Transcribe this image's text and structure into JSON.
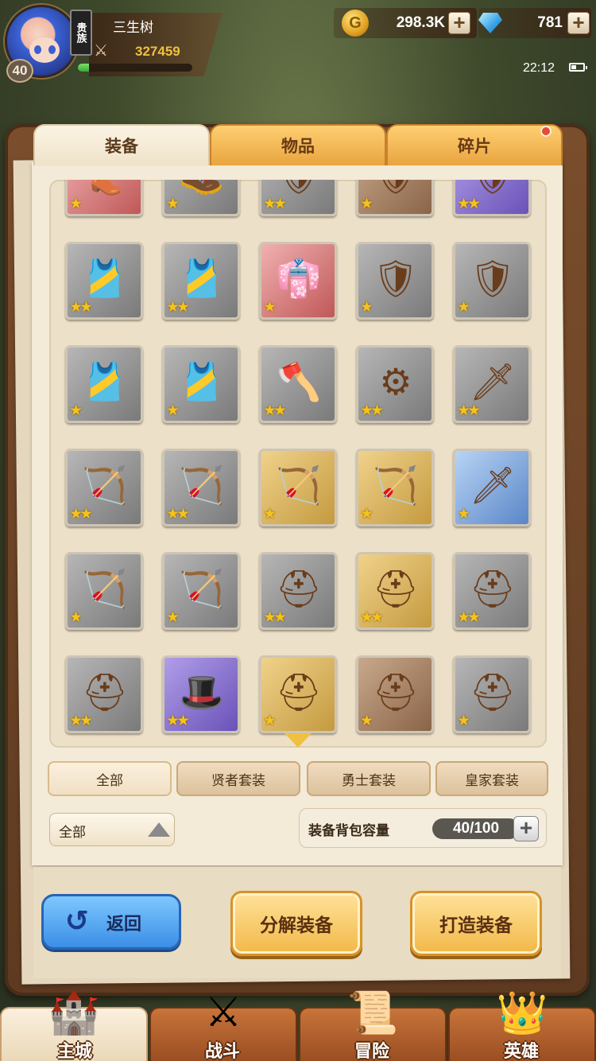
{
  "player": {
    "name": "三生树",
    "level": "40",
    "power": "327459",
    "vip_label": "贵族",
    "exp_fraction": 0.1
  },
  "currencies": {
    "gold": "298.3K",
    "gems": "781"
  },
  "status": {
    "time": "22:12"
  },
  "tabs": [
    {
      "label": "装备",
      "active": true
    },
    {
      "label": "物品",
      "active": false
    },
    {
      "label": "碎片",
      "active": false,
      "has_notification": true
    }
  ],
  "items": [
    {
      "icon": "boots-icon",
      "glyph": "👢",
      "bg": "red",
      "stars": 1
    },
    {
      "icon": "greaves-icon",
      "glyph": "🥾",
      "bg": "gray",
      "stars": 1
    },
    {
      "icon": "round-shield-icon",
      "glyph": "🛡",
      "bg": "gray",
      "stars": 2
    },
    {
      "icon": "kite-shield-icon",
      "glyph": "🛡",
      "bg": "brown",
      "stars": 1
    },
    {
      "icon": "knight-armor-icon",
      "glyph": "🛡",
      "bg": "purple",
      "stars": 2
    },
    {
      "icon": "leather-vest-icon",
      "glyph": "🎽",
      "bg": "gray",
      "stars": 2
    },
    {
      "icon": "leather-vest-icon",
      "glyph": "🎽",
      "bg": "gray",
      "stars": 2
    },
    {
      "icon": "red-robe-icon",
      "glyph": "👘",
      "bg": "red",
      "stars": 1
    },
    {
      "icon": "plate-armor-icon",
      "glyph": "🛡",
      "bg": "gray",
      "stars": 1
    },
    {
      "icon": "plate-armor-icon",
      "glyph": "🛡",
      "bg": "gray",
      "stars": 1
    },
    {
      "icon": "leather-vest-icon",
      "glyph": "🎽",
      "bg": "gray",
      "stars": 1
    },
    {
      "icon": "leather-vest-icon",
      "glyph": "🎽",
      "bg": "gray",
      "stars": 1
    },
    {
      "icon": "axe-icon",
      "glyph": "🪓",
      "bg": "gray",
      "stars": 2
    },
    {
      "icon": "mace-icon",
      "glyph": "⚙",
      "bg": "gray",
      "stars": 2
    },
    {
      "icon": "sword-icon",
      "glyph": "🗡",
      "bg": "gray",
      "stars": 2
    },
    {
      "icon": "bow-icon",
      "glyph": "🏹",
      "bg": "gray",
      "stars": 2
    },
    {
      "icon": "bow-icon",
      "glyph": "🏹",
      "bg": "gray",
      "stars": 2
    },
    {
      "icon": "golden-bow-icon",
      "glyph": "🏹",
      "bg": "gold",
      "stars": 1
    },
    {
      "icon": "golden-bow-icon",
      "glyph": "🏹",
      "bg": "gold",
      "stars": 1
    },
    {
      "icon": "dagger-icon",
      "glyph": "🗡",
      "bg": "blue",
      "stars": 1
    },
    {
      "icon": "bow-icon",
      "glyph": "🏹",
      "bg": "gray",
      "stars": 1
    },
    {
      "icon": "bow-icon",
      "glyph": "🏹",
      "bg": "gray",
      "stars": 1
    },
    {
      "icon": "iron-helmet-icon",
      "glyph": "⛑",
      "bg": "gray",
      "stars": 2
    },
    {
      "icon": "golden-helmet-icon",
      "glyph": "⛑",
      "bg": "gold",
      "stars": 2
    },
    {
      "icon": "bronze-helmet-icon",
      "glyph": "⛑",
      "bg": "gray",
      "stars": 2
    },
    {
      "icon": "bronze-helmet-icon",
      "glyph": "⛑",
      "bg": "gray",
      "stars": 2
    },
    {
      "icon": "wizard-hat-icon",
      "glyph": "🎩",
      "bg": "purple",
      "stars": 2
    },
    {
      "icon": "golden-helmet-icon",
      "glyph": "⛑",
      "bg": "gold",
      "stars": 1
    },
    {
      "icon": "plumed-helmet-icon",
      "glyph": "⛑",
      "bg": "brown",
      "stars": 1
    },
    {
      "icon": "iron-helmet-icon",
      "glyph": "⛑",
      "bg": "gray",
      "stars": 1
    }
  ],
  "filters": [
    {
      "label": "全部",
      "active": true
    },
    {
      "label": "贤者套装",
      "active": false
    },
    {
      "label": "勇士套装",
      "active": false
    },
    {
      "label": "皇家套装",
      "active": false
    }
  ],
  "sort_dropdown": {
    "value": "全部"
  },
  "capacity": {
    "label": "装备背包容量",
    "value": "40/100"
  },
  "actions": {
    "back": "返回",
    "decompose": "分解装备",
    "forge": "打造装备"
  },
  "bottom_nav": [
    {
      "label": "主城",
      "icon": "castle-icon",
      "glyph": "🏰",
      "active": true
    },
    {
      "label": "战斗",
      "icon": "crossed-swords-icon",
      "glyph": "⚔",
      "active": false
    },
    {
      "label": "冒险",
      "icon": "map-scroll-icon",
      "glyph": "📜",
      "active": false
    },
    {
      "label": "英雄",
      "icon": "hero-crest-icon",
      "glyph": "👑",
      "active": false
    }
  ]
}
